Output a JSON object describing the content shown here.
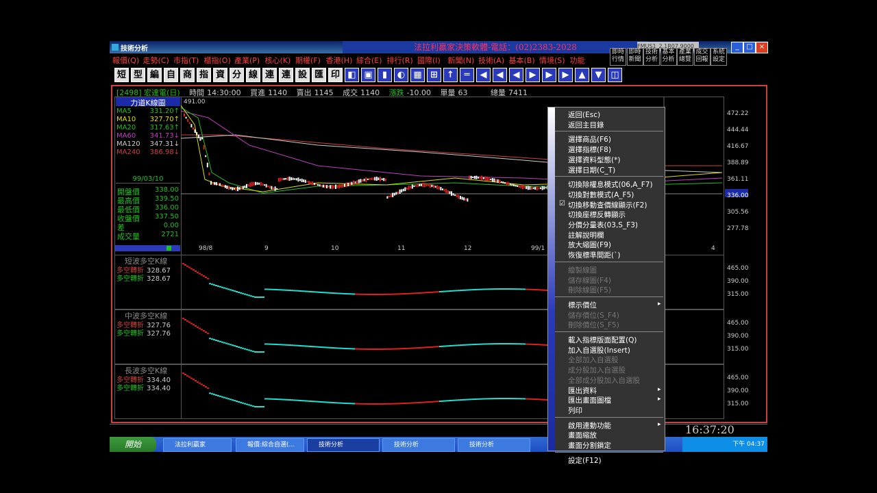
{
  "window": {
    "app_title": "技術分析",
    "banner": "法拉利贏家決策軟體-電話：(02)2383-2028",
    "id_box": "FMUS1_2.1R07.9000",
    "controls": [
      "_",
      "□",
      "×"
    ]
  },
  "menubar": [
    "報價(Q)",
    "走勢(C)",
    "市指(T)",
    "櫃指(O)",
    "產業(P)",
    "核心(K)",
    "期權(F)",
    "香港(H)",
    "綜合(E)",
    "排行(R)",
    "國際(I)",
    "新聞(N)",
    "技術(A)",
    "基本(B)",
    "情境(S)",
    "功能"
  ],
  "quick_buttons": [
    "即時行情",
    "即時新聞",
    "技術分析",
    "基本分析",
    "產業總覽",
    "成交回報",
    "系統設定"
  ],
  "toolbar": [
    "短",
    "型",
    "編",
    "自",
    "商",
    "指",
    "資",
    "分",
    "線",
    "連",
    "連",
    "設",
    "匯",
    "印"
  ],
  "infobar": {
    "symbol": "[2498] 宏達電(日)",
    "time_label": "時間",
    "time": "14:30:00",
    "bid_label": "買進",
    "bid": "1140",
    "ask_label": "賣出",
    "ask": "1145",
    "deal_label": "成交",
    "deal": "1140",
    "change_label": "漲跌",
    "change": "-10.00",
    "unit_vol_label": "單量",
    "unit_vol": "63",
    "total_vol_label": "總量",
    "total_vol": "7411"
  },
  "legend": {
    "title": "力道K線圖",
    "peak_label": "491.00",
    "ma": [
      {
        "name": "MA5",
        "value": "331.20",
        "arrow": "↑",
        "color": "#20c020"
      },
      {
        "name": "MA10",
        "value": "327.70",
        "arrow": "↑",
        "color": "#e0e000"
      },
      {
        "name": "MA20",
        "value": "317.63",
        "arrow": "↑",
        "color": "#20c020"
      },
      {
        "name": "MA60",
        "value": "341.73",
        "arrow": "↓",
        "color": "#c040c0"
      },
      {
        "name": "MA120",
        "value": "347.31",
        "arrow": "↓",
        "color": "#cccccc"
      },
      {
        "name": "MA240",
        "value": "386.98",
        "arrow": "↓",
        "color": "#d04040"
      }
    ]
  },
  "ohlc": {
    "date": "99/03/10",
    "rows": [
      {
        "label": "開盤價",
        "value": "338.00"
      },
      {
        "label": "最高價",
        "value": "339.50"
      },
      {
        "label": "最低價",
        "value": "336.00"
      },
      {
        "label": "收盤價",
        "value": "337.50"
      },
      {
        "label": "差",
        "value": "0.00"
      },
      {
        "label": "成交量",
        "value": "2721"
      }
    ]
  },
  "main_axis": {
    "y": [
      "472.22",
      "444.44",
      "416.67",
      "388.89",
      "361.11",
      "336.00",
      "305.56",
      "277.78"
    ],
    "x": [
      "98/8",
      "9",
      "10",
      "11",
      "12",
      "99/1",
      "4"
    ]
  },
  "sub_panels": [
    {
      "title": "短波多空K線",
      "rows": [
        {
          "label": "多空轉折",
          "value": "328.67",
          "color": "#d04040"
        },
        {
          "label": "多空轉折",
          "value": "328.67",
          "color": "#20c020"
        }
      ],
      "y": [
        "465.00",
        "390.00",
        "315.00"
      ]
    },
    {
      "title": "中波多空K線",
      "rows": [
        {
          "label": "多空轉折",
          "value": "327.76",
          "color": "#d04040"
        },
        {
          "label": "多空轉折",
          "value": "327.76",
          "color": "#20c020"
        }
      ],
      "y": [
        "465.00",
        "390.00",
        "315.00"
      ]
    },
    {
      "title": "長波多空K線",
      "rows": [
        {
          "label": "多空轉折",
          "value": "334.40",
          "color": "#d04040"
        },
        {
          "label": "多空轉折",
          "value": "334.40",
          "color": "#20c020"
        }
      ],
      "y": [
        "465.00",
        "390.00",
        "315.00"
      ]
    }
  ],
  "clock": "16:37:20",
  "taskbar": {
    "start": "開始",
    "tasks": [
      "法拉利贏家",
      "報價:綜合自選(...",
      "技術分析",
      "技術分析",
      "技術分析"
    ],
    "tray_time": "下午 04:37"
  },
  "context_menu": {
    "groups": [
      [
        {
          "label": "返回(Esc)"
        },
        {
          "label": "返回主目錄"
        }
      ],
      [
        {
          "label": "選擇商品(F6)"
        },
        {
          "label": "選擇指標(F8)"
        },
        {
          "label": "選擇資料型態(*)"
        },
        {
          "label": "選擇日期(C_T)"
        }
      ],
      [
        {
          "label": "切換除權息模式(06,A_F7)"
        },
        {
          "label": "切換對數模式(A_F5)"
        },
        {
          "label": "切換移動查價線顯示(F2)",
          "checked": true
        },
        {
          "label": "切換座標反轉顯示"
        },
        {
          "label": "分價分量表(03,S_F3)"
        },
        {
          "label": "註解說明欄"
        },
        {
          "label": "放大縮圖(F9)"
        },
        {
          "label": "恢復標準間距(`)"
        }
      ],
      [
        {
          "label": "繪製線圖",
          "disabled": true
        },
        {
          "label": "儲存線圖(F4)",
          "disabled": true
        },
        {
          "label": "刪除線圖(F5)",
          "disabled": true
        }
      ],
      [
        {
          "label": "標示價位",
          "submenu": true
        },
        {
          "label": "儲存價位(S_F4)",
          "disabled": true
        },
        {
          "label": "刪除價位(S_F5)",
          "disabled": true
        }
      ],
      [
        {
          "label": "載入指標版面配置(Q)"
        },
        {
          "label": "加入自選股(Insert)"
        },
        {
          "label": "全部加入自選股",
          "disabled": true
        },
        {
          "label": "成分股加入自選股",
          "disabled": true
        },
        {
          "label": "全部成分股加入自選股",
          "disabled": true
        },
        {
          "label": "匯出資料",
          "submenu": true
        },
        {
          "label": "匯出畫面圖檔",
          "submenu": true
        },
        {
          "label": "列印"
        }
      ],
      [
        {
          "label": "啟用連動功能",
          "submenu": true
        },
        {
          "label": "畫面縮放"
        },
        {
          "label": "畫面分割鎖定"
        }
      ],
      [
        {
          "label": "設定(F12)"
        }
      ]
    ]
  },
  "colors": {
    "up": "#e02020",
    "down": "#20e0d0",
    "frame": "#d04040",
    "accent": "#1a2aa8"
  }
}
